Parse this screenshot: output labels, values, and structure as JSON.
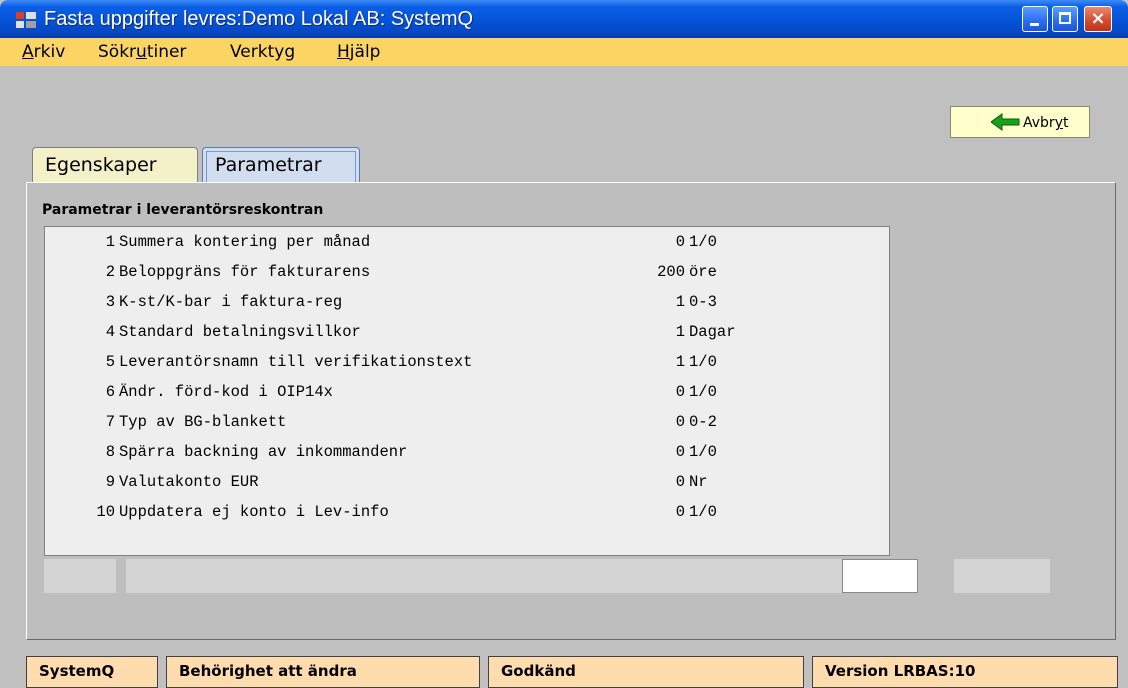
{
  "window": {
    "title": "Fasta uppgifter levres:Demo Lokal AB: SystemQ",
    "close_glyph": "×"
  },
  "menu": {
    "items": [
      {
        "pre": "",
        "u": "A",
        "post": "rkiv"
      },
      {
        "pre": "Sökr",
        "u": "u",
        "post": "tiner"
      },
      {
        "pre": "Verktyg",
        "u": "",
        "post": ""
      },
      {
        "pre": "",
        "u": "H",
        "post": "jälp"
      }
    ]
  },
  "toolbar": {
    "cancel_pre": "Avbr",
    "cancel_u": "y",
    "cancel_post": "t",
    "cancel_icon": "arrow-left-green-icon"
  },
  "tabs": [
    {
      "label": "Egenskaper",
      "active": false
    },
    {
      "label": "Parametrar",
      "active": true
    }
  ],
  "section": {
    "title": "Parametrar i leverantörsreskontran"
  },
  "parameters": [
    {
      "num": "1",
      "text": "Summera kontering per månad",
      "value": "0",
      "unit": "1/0"
    },
    {
      "num": "2",
      "text": "Beloppgräns för fakturarens",
      "value": "200",
      "unit": "öre"
    },
    {
      "num": "3",
      "text": "K-st/K-bar i faktura-reg",
      "value": "1",
      "unit": "0-3"
    },
    {
      "num": "4",
      "text": "Standard betalningsvillkor",
      "value": "1",
      "unit": "Dagar"
    },
    {
      "num": "5",
      "text": "Leverantörsnamn till verifikationstext",
      "value": "1",
      "unit": "1/0"
    },
    {
      "num": "6",
      "text": "Ändr. förd-kod i OIP14x",
      "value": "0",
      "unit": "1/0"
    },
    {
      "num": "7",
      "text": "Typ av BG-blankett",
      "value": "0",
      "unit": "0-2"
    },
    {
      "num": "8",
      "text": "Spärra backning av inkommandenr",
      "value": "0",
      "unit": "1/0"
    },
    {
      "num": "9",
      "text": "Valutakonto EUR",
      "value": "0",
      "unit": "Nr"
    },
    {
      "num": "10",
      "text": "Uppdatera ej konto i Lev-info",
      "value": "0",
      "unit": "1/0"
    }
  ],
  "status": {
    "app": "SystemQ",
    "permission": "Behörighet att ändra",
    "state": "Godkänd",
    "version": "Version LRBAS:10"
  },
  "colors": {
    "menubar": "#fbd564",
    "status_cell": "#ffdcae",
    "cancel_button": "#ffffcc",
    "titlebar": "#0553d8"
  }
}
